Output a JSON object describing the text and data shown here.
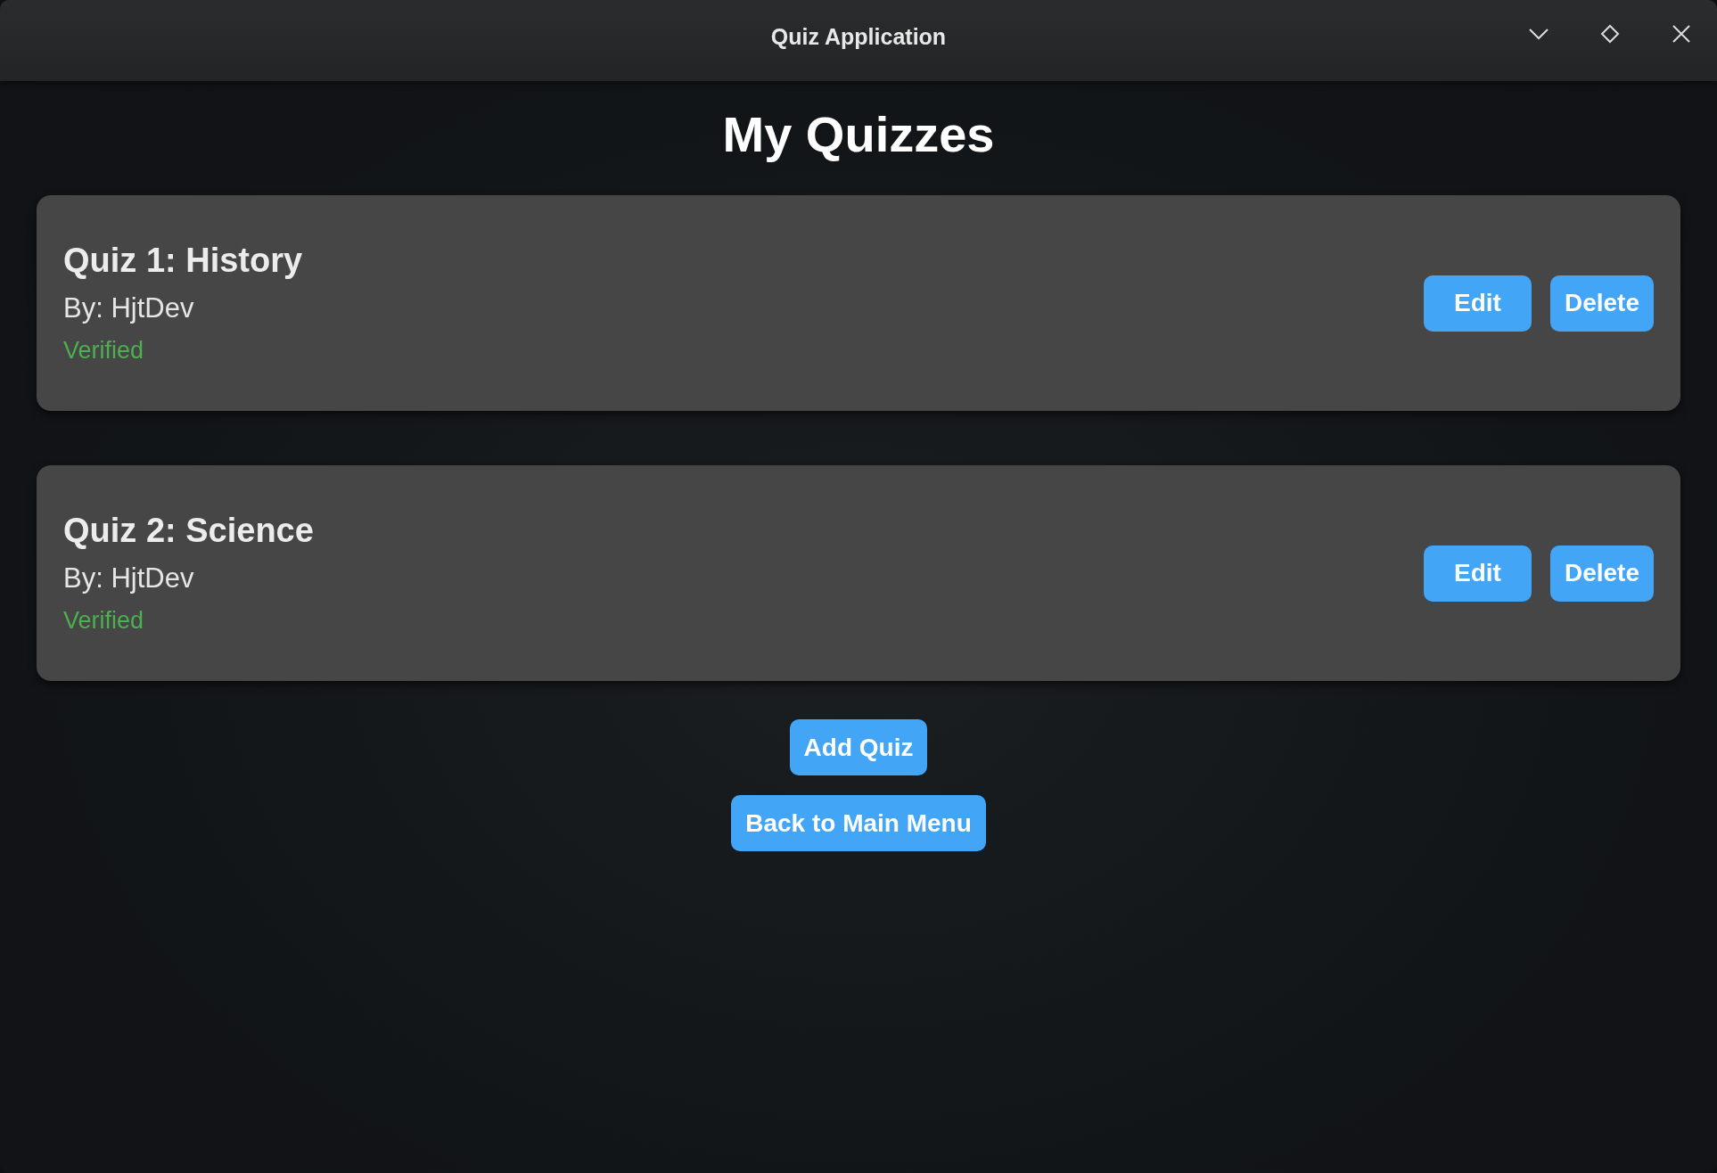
{
  "window": {
    "title": "Quiz Application"
  },
  "heading": "My Quizzes",
  "quizzes": [
    {
      "title": "Quiz 1: History",
      "author": "By: HjtDev",
      "status": "Verified",
      "actions": [
        "Edit",
        "Delete"
      ]
    },
    {
      "title": "Quiz 2: Science",
      "author": "By: HjtDev",
      "status": "Verified",
      "actions": [
        "Edit",
        "Delete"
      ]
    }
  ],
  "buttons": [
    "Add Quiz",
    "Back to Main Menu"
  ]
}
